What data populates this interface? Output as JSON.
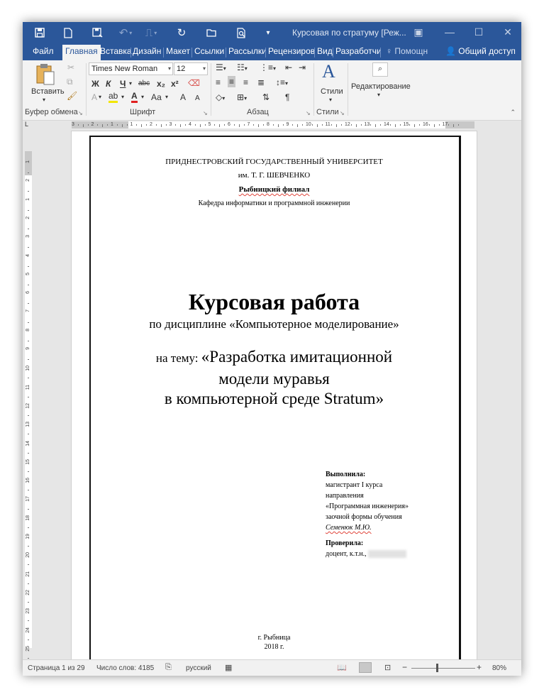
{
  "window": {
    "title": "Курсовая по стратуму [Реж...",
    "quick_access": [
      "save-icon",
      "new-doc-icon",
      "save-as-icon",
      "undo-icon",
      "redo-icon",
      "repeat-icon",
      "open-folder-icon",
      "print-preview-icon",
      "customize-icon"
    ],
    "controls": [
      "ribbon-display-icon",
      "minimize-icon",
      "maximize-icon",
      "close-icon"
    ]
  },
  "tabs": {
    "file": "Файл",
    "home": "Главная",
    "insert": "Вставка",
    "design": "Дизайн",
    "layout": "Макет",
    "references": "Ссылки",
    "mailings": "Рассылки",
    "review": "Рецензиров",
    "view": "Вид",
    "developer": "Разработчи",
    "tell_me": "Помощн",
    "share": "Общий доступ"
  },
  "ribbon": {
    "clipboard": {
      "paste": "Вставить",
      "label": "Буфер обмена"
    },
    "font": {
      "name": "Times New Roman",
      "size": "12",
      "bold": "Ж",
      "italic": "К",
      "underline": "Ч",
      "strike": "abc",
      "subscript": "x₂",
      "superscript": "x²",
      "font_color": "А",
      "case": "Аа",
      "grow": "А",
      "shrink": "А",
      "label": "Шрифт"
    },
    "paragraph": {
      "show_marks": "¶",
      "label": "Абзац"
    },
    "styles": {
      "button": "Стили",
      "label": "Стили"
    },
    "editing": {
      "button": "Редактирование"
    }
  },
  "ruler": {
    "h_ticks": [
      "3",
      "2",
      "1",
      "1",
      "2",
      "3",
      "4",
      "5",
      "6",
      "7",
      "8",
      "9",
      "10",
      "11",
      "12",
      "13",
      "14",
      "15",
      "16",
      "17"
    ],
    "v_ticks": [
      "1",
      "2",
      "1",
      "2",
      "3",
      "4",
      "5",
      "6",
      "7",
      "8",
      "9",
      "10",
      "11",
      "12",
      "13",
      "14",
      "15",
      "16",
      "17",
      "18",
      "19",
      "20",
      "21",
      "22",
      "23",
      "24",
      "25",
      "26"
    ],
    "corner": "L"
  },
  "document": {
    "university": "ПРИДНЕСТРОВСКИЙ ГОСУДАРСТВЕННЫЙ УНИВЕРСИТЕТ",
    "named_after": "им. Т. Г. ШЕВЧЕНКО",
    "branch": "Рыбницкий филиал",
    "department": "Кафедра информатики и программной инженерии",
    "work_type": "Курсовая работа",
    "discipline": "по дисциплине «Компьютерное моделирование»",
    "topic_prefix": "на тему: ",
    "topic_line1": "«Разработка имитационной",
    "topic_line2": "модели муравья",
    "topic_line3": "в компьютерной среде Stratum»",
    "performed_by_label": "Выполнила:",
    "performer_line1": "магистрант I курса",
    "performer_line2": "направления",
    "performer_line3": "«Программная инженерия»",
    "performer_line4": "заочной формы обучения",
    "performer_name": "Семенюк М.Ю.",
    "checked_by_label": "Проверила:",
    "checker": "доцент, к.т.н.,",
    "city": "г. Рыбница",
    "year": "2018 г."
  },
  "status": {
    "page": "Страница 1 из 29",
    "words": "Число слов: 4185",
    "language": "русский",
    "zoom": "80%",
    "zoom_minus": "−",
    "zoom_plus": "+",
    "zoom_level": 0.4
  }
}
